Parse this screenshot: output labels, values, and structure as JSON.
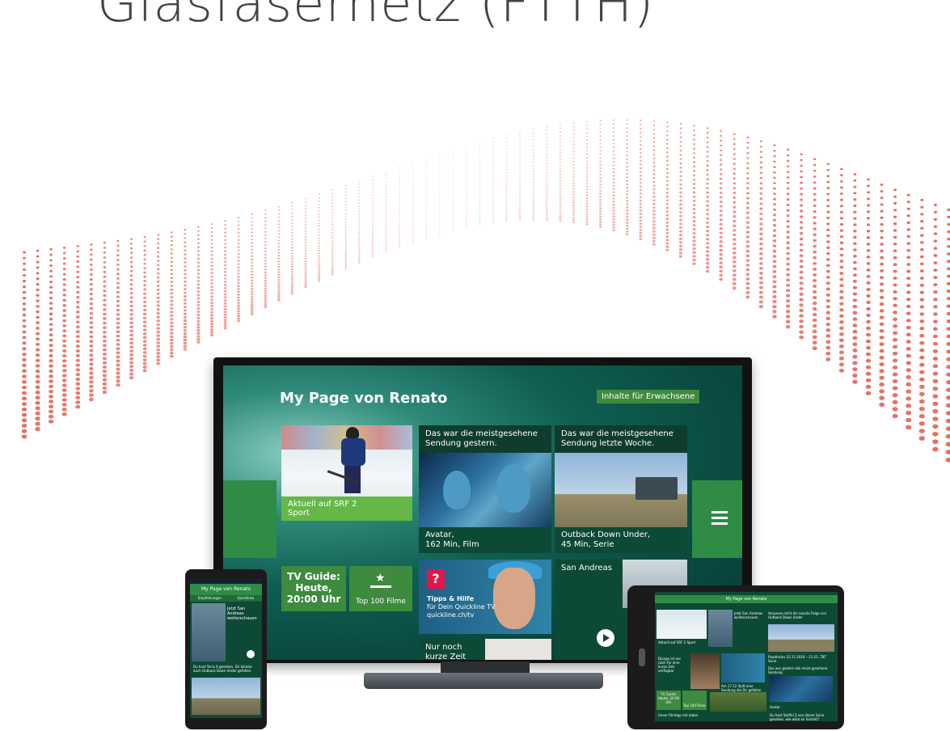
{
  "headline": "Glasfasernetz (FTTH)",
  "tv": {
    "title": "My Page von Renato",
    "adult_button": "Inhalte für Erwachsene",
    "tiles": {
      "sport_caption_1": "Aktuell auf SRF 2",
      "sport_caption_2": "Sport",
      "avatar_header_1": "Das war die meistgesehene",
      "avatar_header_2": "Sendung gestern.",
      "avatar_footer_1": "Avatar,",
      "avatar_footer_2": "162 Min, Film",
      "outback_header_1": "Das war die meistgesehene",
      "outback_header_2": "Sendung letzte Woche.",
      "outback_footer_1": "Outback Down Under,",
      "outback_footer_2": "45 Min, Serie",
      "guide_1": "TV Guide:",
      "guide_2": "Heute,",
      "guide_3": "20:00 Uhr",
      "top100": "Top 100 Filme",
      "tipps_title": "Tipps & Hilfe",
      "tipps_line1": "für Dein Quickline TV",
      "tipps_line2": "quickline.ch/tv",
      "tipps_icon": "?",
      "san_andreas": "San Andreas",
      "nur_1": "Nur noch",
      "nur_2": "kurze Zeit"
    }
  },
  "phone": {
    "title": "My Page von Renato",
    "tab1": "Empfehlungen",
    "tab2": "Quicklines",
    "text1": "Jetzt San Andreas weiterschauen",
    "text2": "Du hast Terra X gesehen. Dir könnte auch Outback Down Under gefallen."
  },
  "tablet": {
    "title": "My Page von Renato",
    "sport": "Aktuell auf SRF 2 Sport",
    "san": "Jetzt San Andreas weiterschauen",
    "outback_q": "Verpasse nicht die neuste Folge von Outback Down Under",
    "outback_info": "Roadtrains 22.11.2016 – 21:15, TBT Serie",
    "django": "Django ist nur noch für eine kurze Zeit verfügbar",
    "guide": "TV Guide: Heute, 20:00 Uhr",
    "top100": "Top 100 Filme",
    "meistgesehen": "Das war gestern die meist gesehene Sendung",
    "staffel": "Am 17.12 läuft eine Sendung die Dir gefallen könnte",
    "avatar": "Avatar",
    "unser": "Unser Filmtipp mit dabei",
    "staffel3": "Du hast Staffel 3 von dieser Serie gesehen. wie wäre es hiermit?"
  }
}
